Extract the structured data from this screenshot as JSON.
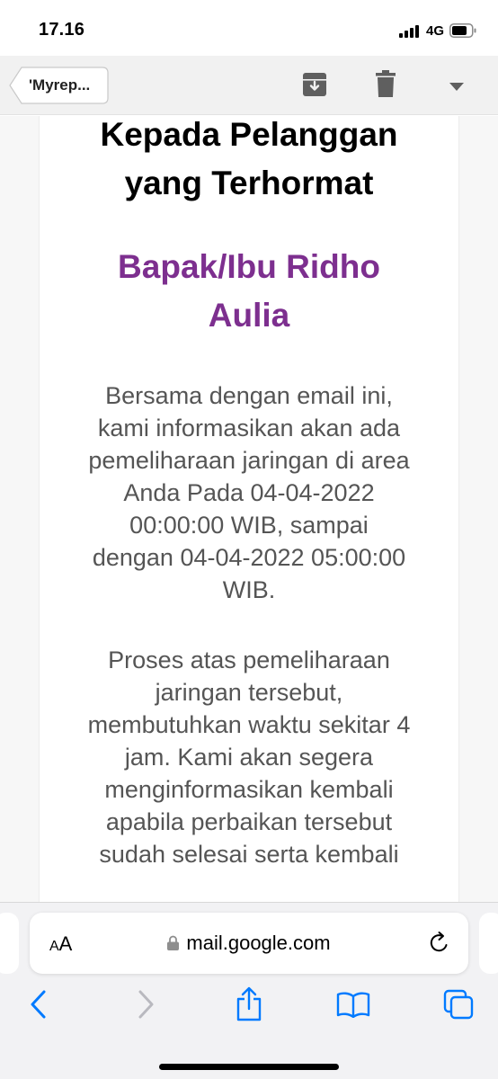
{
  "status_bar": {
    "time": "17.16",
    "network": "4G"
  },
  "toolbar": {
    "back_label": "'Myrep...",
    "icons": [
      "archive-icon",
      "trash-icon",
      "chevron-down-icon"
    ]
  },
  "email": {
    "heading_line1": "Kepada Pelanggan",
    "heading_line2": "yang Terhormat",
    "name_line1": "Bapak/Ibu Ridho",
    "name_line2": "Aulia",
    "paragraph1_lines": [
      "Bersama dengan email ini,",
      "kami informasikan akan ada",
      "pemeliharaan jaringan di area",
      "Anda Pada 04-04-2022",
      "00:00:00 WIB, sampai",
      "dengan 04-04-2022 05:00:00",
      "WIB."
    ],
    "paragraph2_lines": [
      "Proses atas pemeliharaan",
      "jaringan tersebut,",
      "membutuhkan waktu sekitar 4",
      "jam. Kami akan segera",
      "menginformasikan kembali",
      "apabila perbaikan tersebut",
      "sudah selesai serta kembali"
    ],
    "name_color": "#7d2f8f",
    "text_color": "#555555"
  },
  "safari": {
    "aa_large": "A",
    "aa_small": "A",
    "url": "mail.google.com",
    "accent": "#007aff",
    "icons": [
      "back-icon",
      "forward-icon",
      "share-icon",
      "bookmarks-icon",
      "tabs-icon"
    ]
  }
}
